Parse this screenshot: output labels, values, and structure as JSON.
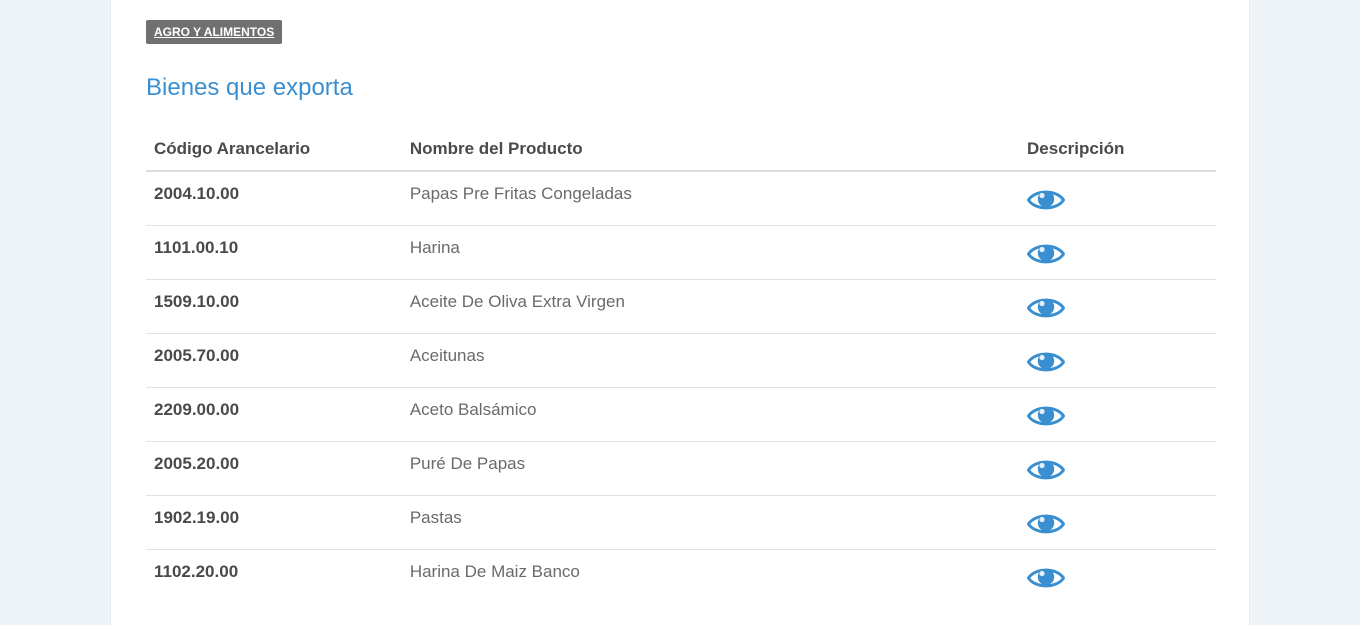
{
  "category_tag": "AGRO Y ALIMENTOS",
  "section_title": "Bienes que exporta",
  "table": {
    "headers": {
      "code": "Código Arancelario",
      "name": "Nombre del Producto",
      "description": "Descripción"
    },
    "rows": [
      {
        "code": "2004.10.00",
        "name": "Papas Pre Fritas Congeladas",
        "icon": "eye-icon"
      },
      {
        "code": "1101.00.10",
        "name": "Harina",
        "icon": "eye-icon"
      },
      {
        "code": "1509.10.00",
        "name": "Aceite De Oliva Extra Virgen",
        "icon": "eye-icon"
      },
      {
        "code": "2005.70.00",
        "name": "Aceitunas",
        "icon": "eye-icon"
      },
      {
        "code": "2209.00.00",
        "name": "Aceto Balsámico",
        "icon": "eye-icon"
      },
      {
        "code": "2005.20.00",
        "name": "Puré De Papas",
        "icon": "eye-icon"
      },
      {
        "code": "1902.19.00",
        "name": "Pastas",
        "icon": "eye-icon"
      },
      {
        "code": "1102.20.00",
        "name": "Harina De Maiz Banco",
        "icon": "eye-icon"
      }
    ]
  },
  "colors": {
    "accent": "#3a8fd0",
    "tag_bg": "#707070",
    "page_bg": "#eef3f8"
  }
}
